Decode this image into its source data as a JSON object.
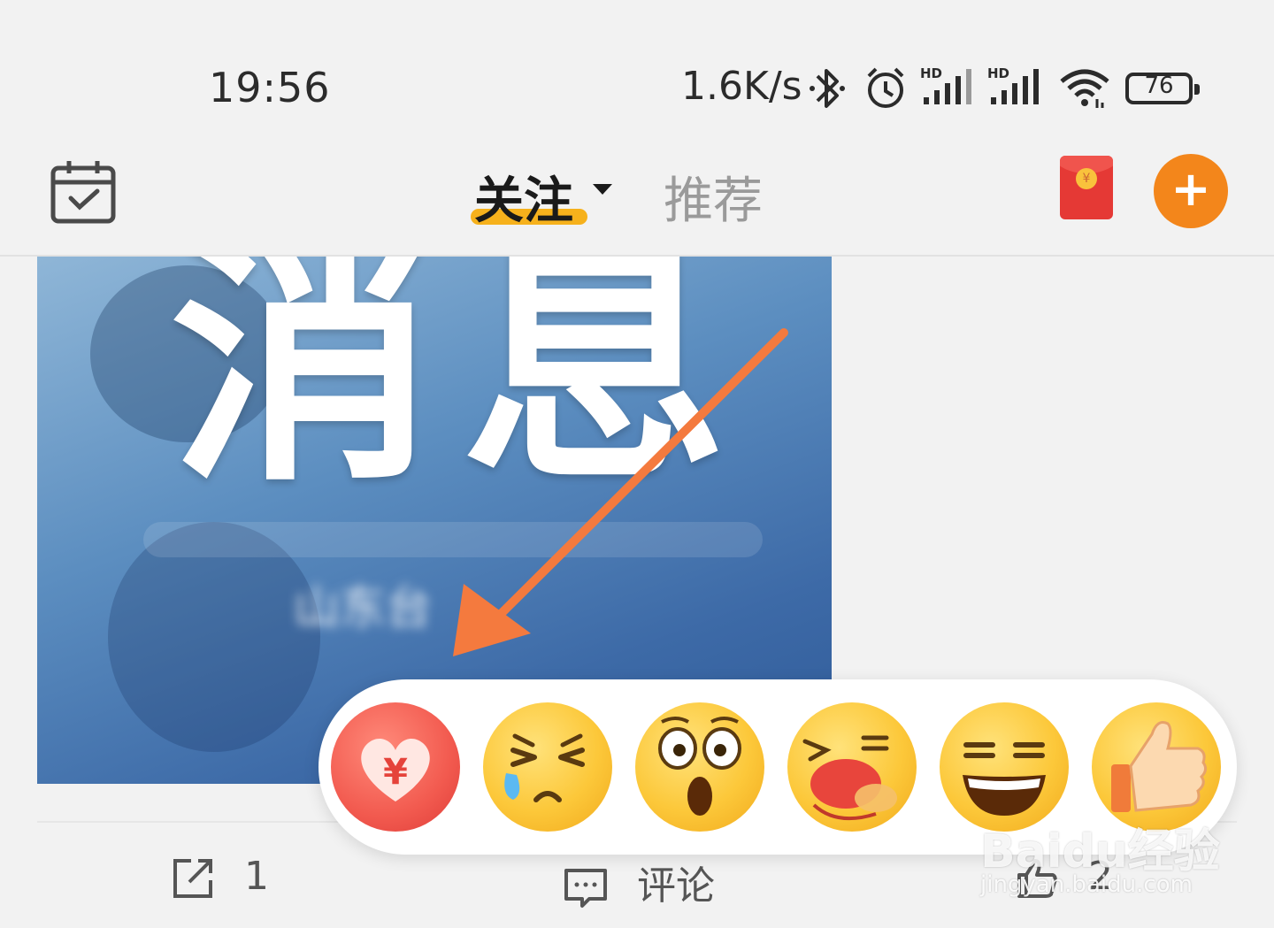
{
  "status_bar": {
    "time": "19:56",
    "net_speed": "1.6K/s",
    "battery": "76",
    "icons": [
      "bluetooth-icon",
      "alarm-icon",
      "signal-hd-icon",
      "signal-hd-icon",
      "wifi-icon",
      "battery-icon"
    ]
  },
  "nav": {
    "tab_follow": "关注",
    "tab_recommend": "推荐",
    "accent_color": "#f6b11c",
    "add_button_color": "#f3861b",
    "add_symbol": "+",
    "coin_symbol": "¥"
  },
  "post": {
    "image_text": "消息",
    "image_subtitle": "山东台"
  },
  "reactions": {
    "items": [
      "heart-yuan-icon",
      "crying-face-icon",
      "shocked-face-icon",
      "laughing-hand-face-icon",
      "grinning-face-icon",
      "thumbs-up-icon"
    ],
    "yuan_symbol": "¥"
  },
  "actions": {
    "share_count": "1",
    "comment_label": "评论",
    "like_count": "2"
  },
  "watermark": {
    "main": "Baidu经验",
    "sub": "jingyan.baidu.com"
  }
}
